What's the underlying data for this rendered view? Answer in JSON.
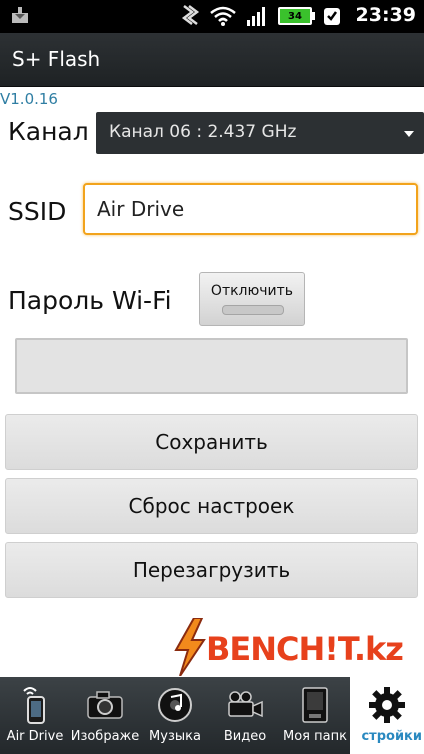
{
  "status_bar": {
    "battery": "34",
    "time": "23:39"
  },
  "app": {
    "title": "S+ Flash",
    "version": "V1.0.16"
  },
  "form": {
    "channel_label": "Канал",
    "channel_value": "Канал 06 : 2.437 GHz",
    "ssid_label": "SSID",
    "ssid_value": "Air Drive",
    "password_label": "Пароль Wi-Fi",
    "password_toggle_label": "Отключить",
    "password_value": ""
  },
  "actions": {
    "save": "Сохранить",
    "reset": "Сброс настроек",
    "restart": "Перезагрузить"
  },
  "watermark": {
    "text": "BENCH!T.kz"
  },
  "tabs": [
    {
      "label": "Air Drive",
      "icon": "phone-wifi-icon"
    },
    {
      "label": "Изображе",
      "icon": "camera-icon"
    },
    {
      "label": "Музыка",
      "icon": "music-disc-icon"
    },
    {
      "label": "Видео",
      "icon": "video-camera-icon"
    },
    {
      "label": "Моя папк",
      "icon": "folder-device-icon"
    },
    {
      "label": "стройки",
      "icon": "gear-icon",
      "active": true
    }
  ],
  "colors": {
    "accent_orange": "#f2a31b",
    "active_tab_text": "#2a89c0",
    "watermark_red": "#e7411c"
  }
}
